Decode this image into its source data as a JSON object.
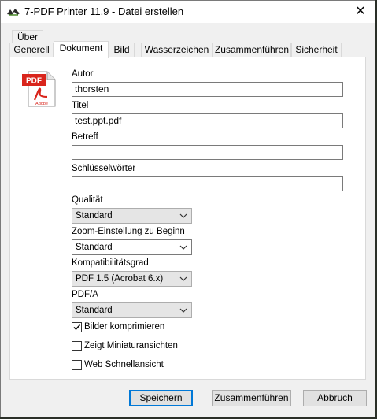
{
  "window": {
    "title": "7-PDF Printer 11.9 - Datei erstellen",
    "close_glyph": "✕"
  },
  "tabs_row1": [
    {
      "label": "Über"
    }
  ],
  "tabs_row2": [
    {
      "label": "Generell"
    },
    {
      "label": "Dokument",
      "active": true
    },
    {
      "label": "Bild"
    },
    {
      "label": "Wasserzeichen"
    },
    {
      "label": "Zusammenführen"
    },
    {
      "label": "Sicherheit"
    }
  ],
  "pdf_icon": {
    "badge_text": "PDF",
    "brand_text": "Adobe",
    "accent": "#d9251c",
    "icon": "pdf-file-icon"
  },
  "fields": {
    "author": {
      "label": "Autor",
      "value": "thorsten"
    },
    "title": {
      "label": "Titel",
      "value": "test.ppt.pdf"
    },
    "subject": {
      "label": "Betreff",
      "value": ""
    },
    "keywords": {
      "label": "Schlüsselwörter",
      "value": ""
    }
  },
  "selects": {
    "quality": {
      "label": "Qualität",
      "value": "Standard"
    },
    "zoom": {
      "label": "Zoom-Einstellung zu Beginn",
      "value": "Standard"
    },
    "compat": {
      "label": "Kompatibilitätsgrad",
      "value": "PDF 1.5 (Acrobat 6.x)"
    },
    "pdfa": {
      "label": "PDF/A",
      "value": "Standard"
    }
  },
  "checkboxes": {
    "compress_images": {
      "label": "Bilder komprimieren",
      "checked": true
    },
    "thumbnails": {
      "label": "Zeigt Miniaturansichten",
      "checked": false
    },
    "fast_web": {
      "label": "Web Schnellansicht",
      "checked": false
    }
  },
  "buttons": {
    "save": "Speichern",
    "merge": "Zusammenführen",
    "cancel": "Abbruch"
  },
  "colors": {
    "default_button_border": "#0078d7",
    "titlebar_bg": "#ffffff",
    "dialog_bg": "#f0f0f0"
  }
}
